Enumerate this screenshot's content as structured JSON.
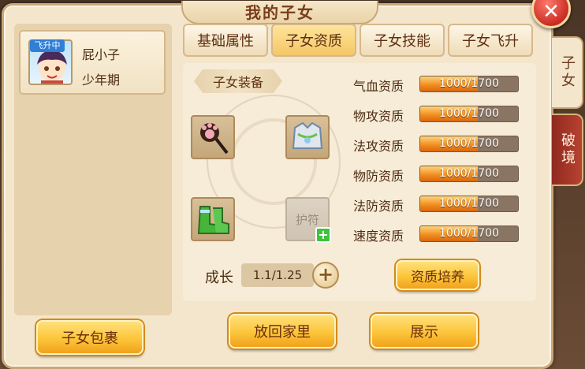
{
  "window": {
    "title": "我的子女",
    "close_icon": "close-icon"
  },
  "side_tabs": [
    {
      "label": "子女",
      "active": true
    },
    {
      "label": "破境",
      "active": false
    }
  ],
  "child": {
    "status_badge": "飞升中",
    "name": "屁小子",
    "stage": "少年期"
  },
  "left_buttons": {
    "bag": "子女包裹"
  },
  "tabs": [
    {
      "label": "基础属性",
      "active": false
    },
    {
      "label": "子女资质",
      "active": true
    },
    {
      "label": "子女技能",
      "active": false
    },
    {
      "label": "子女飞升",
      "active": false
    }
  ],
  "equipment": {
    "section_label": "子女装备",
    "slots": [
      {
        "icon": "cat-paw-wand-icon",
        "filled": true
      },
      {
        "icon": "armor-vest-icon",
        "filled": true
      },
      {
        "icon": "green-boots-icon",
        "filled": true
      },
      {
        "icon": "",
        "filled": false,
        "label": "护符"
      }
    ],
    "add_icon": "plus-icon"
  },
  "growth": {
    "label": "成长",
    "value": "1.1/1.25",
    "plus_icon": "plus-icon"
  },
  "aptitudes": [
    {
      "label": "气血资质",
      "current": 1000,
      "max": 1700,
      "text": "1000/1700"
    },
    {
      "label": "物攻资质",
      "current": 1000,
      "max": 1700,
      "text": "1000/1700"
    },
    {
      "label": "法攻资质",
      "current": 1000,
      "max": 1700,
      "text": "1000/1700"
    },
    {
      "label": "物防资质",
      "current": 1000,
      "max": 1700,
      "text": "1000/1700"
    },
    {
      "label": "法防资质",
      "current": 1000,
      "max": 1700,
      "text": "1000/1700"
    },
    {
      "label": "速度资质",
      "current": 1000,
      "max": 1700,
      "text": "1000/1700"
    }
  ],
  "buttons": {
    "train": "资质培养",
    "send_home": "放回家里",
    "show": "展示"
  },
  "colors": {
    "accent_gold": "#fcc53a",
    "bar_fill": "#f08a1c",
    "close_red": "#c92c24"
  }
}
